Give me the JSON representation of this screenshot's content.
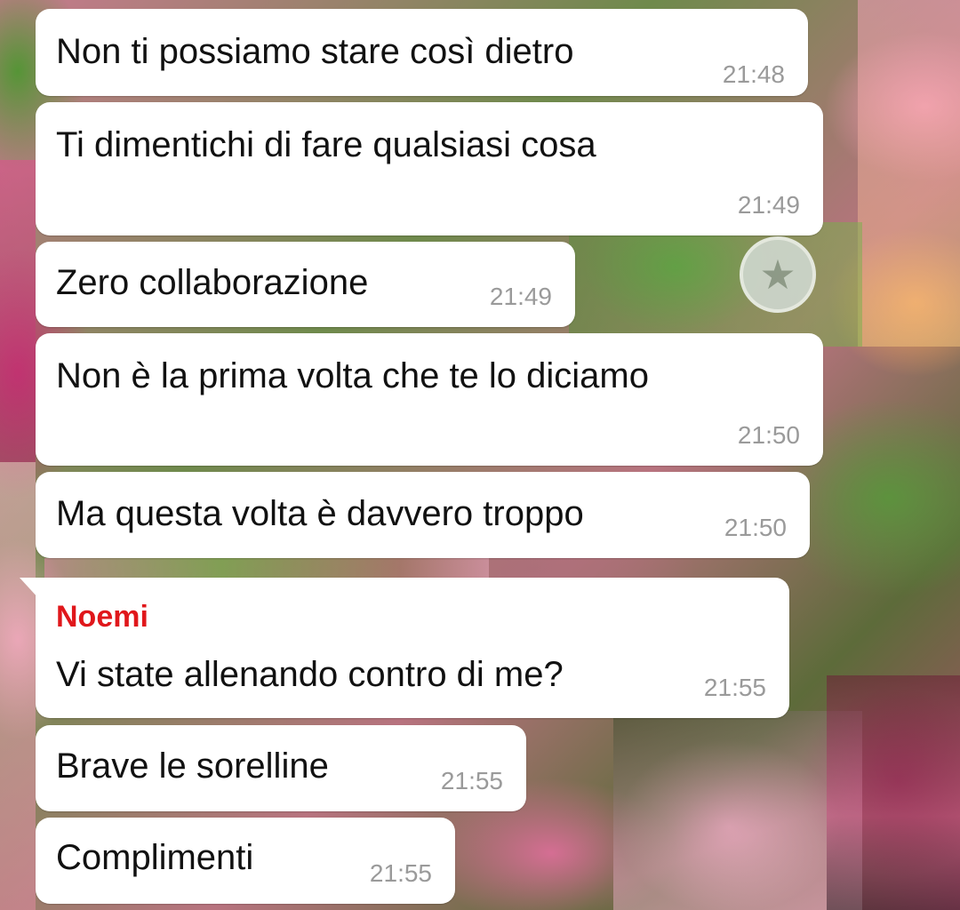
{
  "messages": [
    {
      "text": "Non ti possiamo stare così dietro",
      "time": "21:48"
    },
    {
      "text": "Ti dimentichi di fare qualsiasi cosa",
      "time": "21:49"
    },
    {
      "text": "Zero collaborazione",
      "time": "21:49"
    },
    {
      "text": "Non è la prima volta che te lo diciamo",
      "time": "21:50"
    },
    {
      "text": "Ma questa volta è davvero troppo",
      "time": "21:50"
    },
    {
      "sender": "Noemi",
      "text": "Vi state allenando contro di me?",
      "time": "21:55"
    },
    {
      "text": "Brave le sorelline",
      "time": "21:55"
    },
    {
      "text": "Complimenti",
      "time": "21:55"
    }
  ],
  "colors": {
    "bubble": "#ffffff",
    "text": "#111111",
    "timestamp": "#9a9a9a",
    "sender_name": "#e0171b"
  }
}
